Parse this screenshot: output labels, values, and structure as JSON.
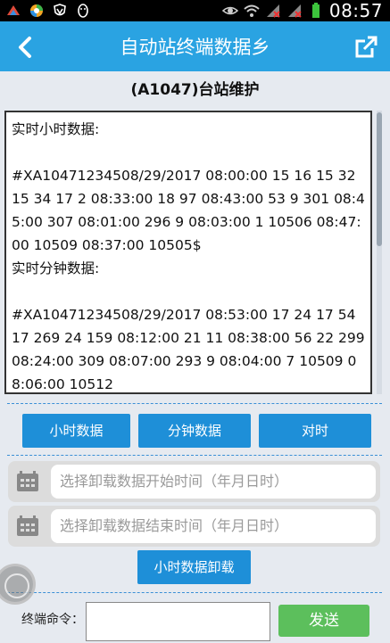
{
  "status_bar": {
    "time": "08:57"
  },
  "app_bar": {
    "title": "自动站终端数据乡"
  },
  "station_title": "(A1047)台站维护",
  "data_box": {
    "hour_label": "实时小时数据:",
    "hour_data": "#XA10471234508/29/2017 08:00:00 15 16 15 32 15 34 17 2 08:33:00 18 97 08:43:00 53 9 301 08:45:00 307 08:01:00 296 9 08:03:00 1 10506 08:47:00 10509 08:37:00 10505$",
    "minute_label": "实时分钟数据:",
    "minute_data": "#XA10471234508/29/2017 08:53:00 17 24 17 54 17 269 24 159 08:12:00 21 11 08:38:00 56 22 299 08:24:00 309 08:07:00 293 9 08:04:00 7 10509 08:06:00 10512"
  },
  "buttons": {
    "hour_data": "小时数据",
    "minute_data": "分钟数据",
    "time_sync": "对时",
    "download_hour": "小时数据卸载",
    "send": "发送"
  },
  "date_inputs": {
    "start_placeholder": "选择卸载数据开始时间（年月日时）",
    "end_placeholder": "选择卸载数据结束时间（年月日时）"
  },
  "command": {
    "label": "终端命令：",
    "value": ""
  },
  "colors": {
    "app_bar": "#2aa3e2",
    "button": "#1e8fd8",
    "send": "#5cbf5c"
  }
}
